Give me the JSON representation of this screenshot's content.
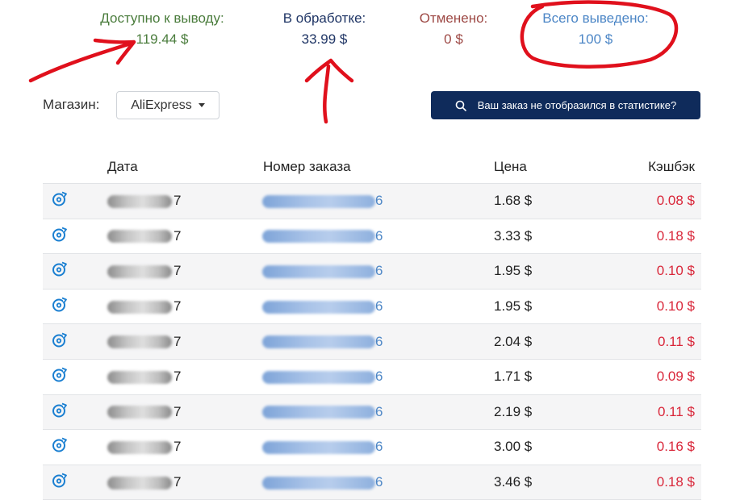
{
  "stats": {
    "available": {
      "label": "Доступно к выводу:",
      "value": "119.44 $"
    },
    "processing": {
      "label": "В обработке:",
      "value": "33.99 $"
    },
    "cancelled": {
      "label": "Отменено:",
      "value": "0 $"
    },
    "withdrawn": {
      "label": "Всего выведено:",
      "value": "100 $"
    }
  },
  "controls": {
    "shop_label": "Магазин:",
    "shop_value": "AliExpress",
    "missing_order_button": "Ваш заказ не отобразился в статистике?"
  },
  "table": {
    "headers": {
      "date": "Дата",
      "order": "Номер заказа",
      "price": "Цена",
      "cashback": "Кэшбэк"
    },
    "rows": [
      {
        "date_tail": "7",
        "order_tail": "6",
        "price": "1.68 $",
        "cashback": "0.08 $"
      },
      {
        "date_tail": "7",
        "order_tail": "6",
        "price": "3.33 $",
        "cashback": "0.18 $"
      },
      {
        "date_tail": "7",
        "order_tail": "6",
        "price": "1.95 $",
        "cashback": "0.10 $"
      },
      {
        "date_tail": "7",
        "order_tail": "6",
        "price": "1.95 $",
        "cashback": "0.10 $"
      },
      {
        "date_tail": "7",
        "order_tail": "6",
        "price": "2.04 $",
        "cashback": "0.11 $"
      },
      {
        "date_tail": "7",
        "order_tail": "6",
        "price": "1.71 $",
        "cashback": "0.09 $"
      },
      {
        "date_tail": "7",
        "order_tail": "6",
        "price": "2.19 $",
        "cashback": "0.11 $"
      },
      {
        "date_tail": "7",
        "order_tail": "6",
        "price": "3.00 $",
        "cashback": "0.16 $"
      },
      {
        "date_tail": "7",
        "order_tail": "6",
        "price": "3.46 $",
        "cashback": "0.18 $"
      }
    ]
  },
  "colors": {
    "available": "#4a7c3c",
    "processing": "#1f3565",
    "cancelled": "#9e4a46",
    "withdrawn": "#4c86c6",
    "cashback": "#d9273a",
    "button_bg": "#0f2b5b",
    "annotation": "#e0101c"
  },
  "icons": {
    "row_status": "refresh-icon",
    "button": "search-icon"
  }
}
